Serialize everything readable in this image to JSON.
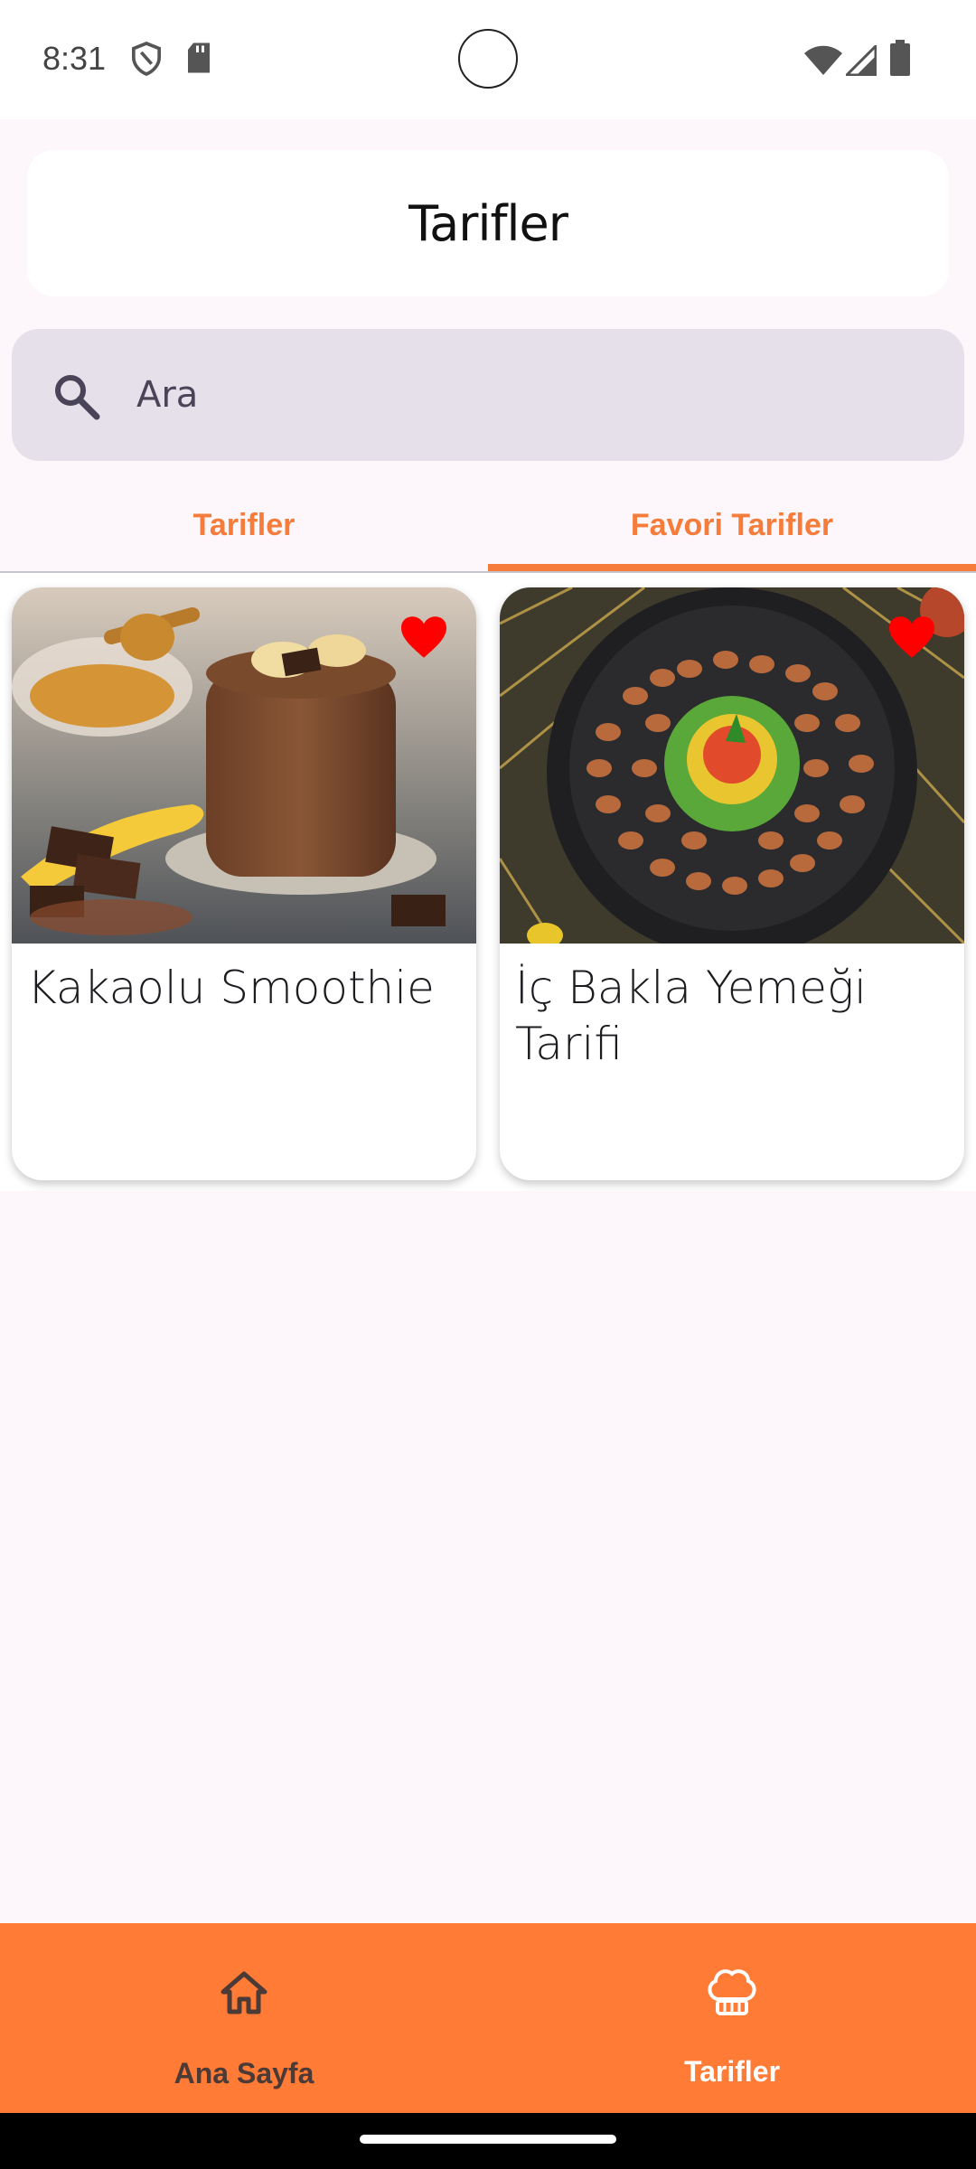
{
  "status_bar": {
    "time": "8:31"
  },
  "header": {
    "title": "Tarifler"
  },
  "search": {
    "placeholder": "Ara",
    "value": ""
  },
  "tabs": [
    {
      "label": "Tarifler",
      "selected": false
    },
    {
      "label": "Favori Tarifler",
      "selected": true
    }
  ],
  "recipes": [
    {
      "title": "Kakaolu Smoothie",
      "favorite": true,
      "image": "chocolate-smoothie-photo"
    },
    {
      "title": "İç Bakla Yemeği Tarifi",
      "favorite": true,
      "image": "fava-bean-dish-photo"
    }
  ],
  "bottom_nav": {
    "items": [
      {
        "label": "Ana Sayfa",
        "icon": "home-icon",
        "selected": false
      },
      {
        "label": "Tarifler",
        "icon": "chef-hat-icon",
        "selected": true
      }
    ]
  },
  "colors": {
    "accent": "#f57c3a",
    "nav_background": "#ff7b36",
    "search_background": "#e6e0ea",
    "heart": "#ff0000"
  }
}
